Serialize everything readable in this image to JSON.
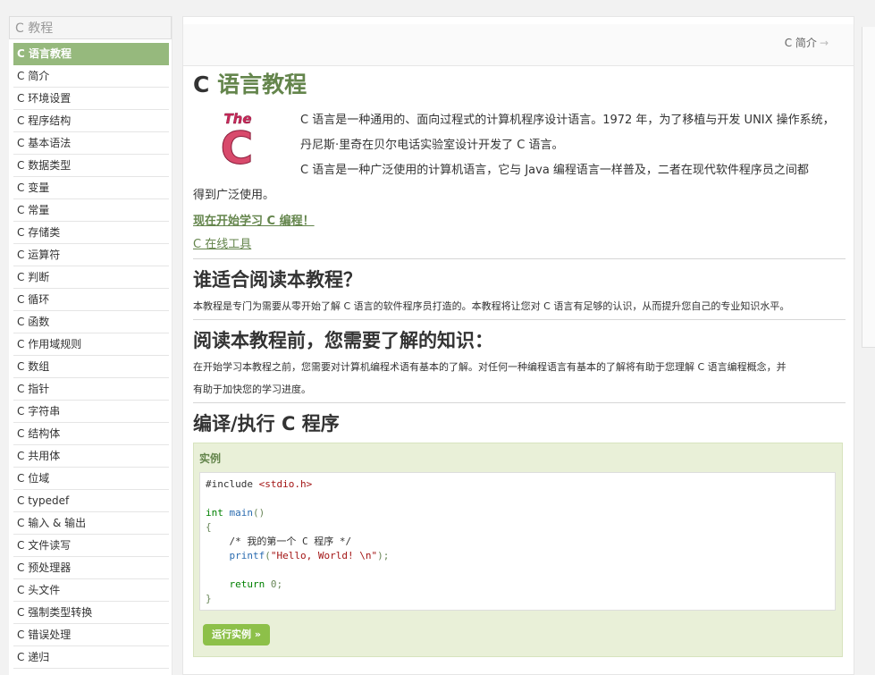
{
  "sidebar": {
    "header": "C 教程",
    "items": [
      "C 语言教程",
      "C 简介",
      "C 环境设置",
      "C 程序结构",
      "C 基本语法",
      "C 数据类型",
      "C 变量",
      "C 常量",
      "C 存储类",
      "C 运算符",
      "C 判断",
      "C 循环",
      "C 函数",
      "C 作用域规则",
      "C 数组",
      "C 指针",
      "C 字符串",
      "C 结构体",
      "C 共用体",
      "C 位域",
      "C typedef",
      "C 输入 & 输出",
      "C 文件读写",
      "C 预处理器",
      "C 头文件",
      "C 强制类型转换",
      "C 错误处理",
      "C 递归"
    ],
    "active_index": 0
  },
  "topnav": {
    "next_label": "C 简介",
    "next_arrow": "→"
  },
  "main": {
    "title_prefix": "C ",
    "title_highlight": "语言教程",
    "logo_text": "The",
    "logo_letter": "C",
    "intro_p1": "C 语言是一种通用的、面向过程式的计算机程序设计语言。1972 年，为了移植与开发 UNIX 操作系统，丹尼斯·里奇在贝尔电话实验室设计开发了 C 语言。",
    "intro_p2_a": "C 语言是一种广泛使用的计算机语言，它与 Java 编程语言一样普及，二者在现代软件程序员之间都",
    "intro_p2_b": "得到广泛使用。",
    "start_link": "现在开始学习 C 编程！",
    "online_tools": "C 在线工具",
    "section1_title": "谁适合阅读本教程？",
    "section1_text": "本教程是专门为需要从零开始了解 C 语言的软件程序员打造的。本教程将让您对 C 语言有足够的认识，从而提升您自己的专业知识水平。",
    "section2_title": "阅读本教程前，您需要了解的知识：",
    "section2_text_a": "在开始学习本教程之前，您需要对计算机编程术语有基本的了解。对任何一种编程语言有基本的了解将有助于您理解 C 语言编程概念，并",
    "section2_text_b": "有助于加快您的学习进度。",
    "section3_title": "编译/执行 C 程序",
    "example_title": "实例",
    "code": {
      "l1a": "#include ",
      "l1b": "<stdio.h>",
      "l3a": "int",
      "l3b": " main",
      "l3c": "()",
      "l4": "{",
      "l5": "    /* 我的第一个 C 程序 */",
      "l6a": "    printf",
      "l6b": "(",
      "l6c": "\"Hello, World! \\n\"",
      "l6d": ");",
      "l8a": "    return",
      "l8b": " 0;",
      "l9": "}"
    },
    "run_button": "运行实例 »"
  },
  "colors": {
    "accent_green": "#64854c",
    "sidebar_active": "#96b97d",
    "run_button": "#8dc049",
    "example_bg": "#e9f0d8"
  }
}
